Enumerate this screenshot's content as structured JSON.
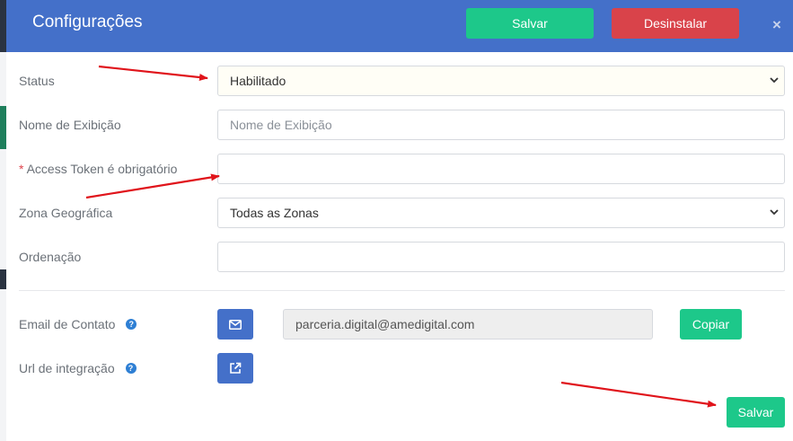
{
  "header": {
    "title": "Configurações",
    "save_label": "Salvar",
    "uninstall_label": "Desinstalar",
    "close_symbol": "×"
  },
  "form": {
    "status_label": "Status",
    "status_value": "Habilitado",
    "display_name_label": "Nome de Exibição",
    "display_name_placeholder": "Nome de Exibição",
    "access_token_required_mark": "*",
    "access_token_label": "Access Token é obrigatório",
    "access_token_value": "",
    "zone_label": "Zona Geográfica",
    "zone_value": "Todas as Zonas",
    "order_label": "Ordenação",
    "order_value": ""
  },
  "contact": {
    "email_label": "Email de Contato",
    "email_value": "parceria.digital@amedigital.com",
    "copy_label": "Copiar",
    "url_label": "Url de integração",
    "help_symbol": "?"
  },
  "footer": {
    "save_label": "Salvar"
  },
  "colors": {
    "header_bg": "#4470c9",
    "primary_green": "#1dc88a",
    "danger_red": "#d9434a",
    "arrow_red": "#e0141b"
  },
  "icons": {
    "email_button": "envelope-icon",
    "url_button": "external-link-icon",
    "help": "question-circle-icon",
    "close": "close-icon"
  }
}
